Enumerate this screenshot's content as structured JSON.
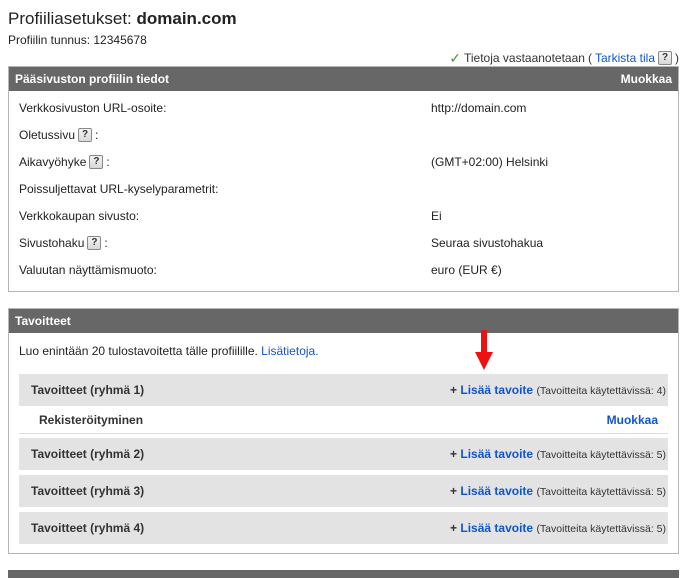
{
  "header": {
    "title_prefix": "Profiiliasetukset: ",
    "title_domain": "domain",
    "title_suffix": ".com",
    "profile_id": "Profiilin tunnus: 12345678"
  },
  "status": {
    "text": "Tietoja vastaanotetaan",
    "open_paren": "(",
    "link": "Tarkista tila",
    "close_paren": ")"
  },
  "help_glyph": "?",
  "profile_panel": {
    "title": "Pääsivuston profiilin tiedot",
    "edit_label": "Muokkaa",
    "rows": [
      {
        "label": "Verkkosivuston URL-osoite:",
        "help": false,
        "value": "http://domain.com"
      },
      {
        "label": "Oletussivu",
        "help": true,
        "value": ""
      },
      {
        "label": "Aikavyöhyke",
        "help": true,
        "value": "(GMT+02:00) Helsinki"
      },
      {
        "label": "Poissuljettavat URL-kyselyparametrit:",
        "help": false,
        "value": ""
      },
      {
        "label": "Verkkokaupan sivusto:",
        "help": false,
        "value": "Ei"
      },
      {
        "label": "Sivustohaku",
        "help": true,
        "value": "Seuraa sivustohakua"
      },
      {
        "label": "Valuutan näyttämismuoto:",
        "help": false,
        "value": "euro (EUR €)"
      }
    ]
  },
  "goals_panel": {
    "title": "Tavoitteet",
    "intro_text": "Luo enintään 20 tulostavoitetta tälle profiilille.",
    "intro_link": "Lisätietoja.",
    "add_label": "Lisää tavoite",
    "groups": [
      {
        "name": "Tavoitteet (ryhmä 1)",
        "available": "(Tavoitteita käytettävissä: 4)"
      },
      {
        "name": "Tavoitteet (ryhmä 2)",
        "available": "(Tavoitteita käytettävissä: 5)"
      },
      {
        "name": "Tavoitteet (ryhmä 3)",
        "available": "(Tavoitteita käytettävissä: 5)"
      },
      {
        "name": "Tavoitteet (ryhmä 4)",
        "available": "(Tavoitteita käytettävissä: 5)"
      }
    ],
    "goal_items": [
      {
        "name": "Rekisteröityminen",
        "edit_label": "Muokkaa"
      }
    ]
  },
  "colors": {
    "header_bg": "#676767",
    "link": "#1155cc",
    "group_bg": "#e3e3e3",
    "check": "#3a9b3a",
    "arrow": "#ee1111"
  }
}
